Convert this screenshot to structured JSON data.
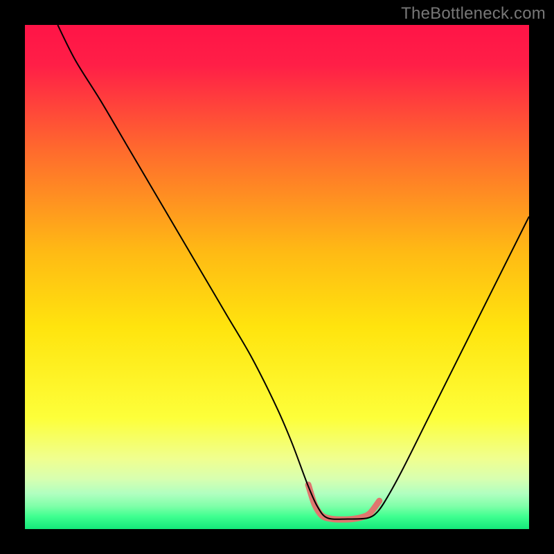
{
  "watermark": "TheBottleneck.com",
  "chart_data": {
    "type": "line",
    "title": "",
    "xlabel": "",
    "ylabel": "",
    "xlim": [
      0,
      100
    ],
    "ylim": [
      0,
      100
    ],
    "legend": false,
    "grid": false,
    "background_gradient": {
      "stops": [
        {
          "offset": 0.0,
          "color": "#ff1447"
        },
        {
          "offset": 0.08,
          "color": "#ff1f47"
        },
        {
          "offset": 0.25,
          "color": "#ff6b2d"
        },
        {
          "offset": 0.45,
          "color": "#ffba14"
        },
        {
          "offset": 0.6,
          "color": "#ffe40e"
        },
        {
          "offset": 0.78,
          "color": "#fdff3a"
        },
        {
          "offset": 0.86,
          "color": "#f0ff8f"
        },
        {
          "offset": 0.9,
          "color": "#d8ffb0"
        },
        {
          "offset": 0.93,
          "color": "#b0ffc0"
        },
        {
          "offset": 0.955,
          "color": "#7effa8"
        },
        {
          "offset": 0.975,
          "color": "#3fff90"
        },
        {
          "offset": 1.0,
          "color": "#14e87a"
        }
      ]
    },
    "series": [
      {
        "name": "bottleneck-curve",
        "color": "#000000",
        "width": 2,
        "x": [
          6.5,
          10,
          15,
          20,
          25,
          30,
          35,
          40,
          45,
          50,
          53,
          56,
          58,
          60,
          64,
          68,
          70,
          72,
          75,
          80,
          85,
          90,
          95,
          100
        ],
        "y": [
          100,
          93,
          85,
          76.5,
          68,
          59.5,
          51,
          42.5,
          34,
          24,
          17,
          9,
          4.5,
          2.2,
          2.0,
          2.2,
          3.5,
          6.5,
          12,
          22,
          32,
          42,
          52,
          62
        ]
      },
      {
        "name": "trough-highlight",
        "color": "#e0766f",
        "width": 9,
        "linecap": "round",
        "x": [
          56.2,
          57.5,
          59,
          61,
          63,
          65,
          67,
          68.5,
          70.3
        ],
        "y": [
          8.8,
          4.8,
          2.6,
          2.0,
          1.9,
          2.0,
          2.4,
          3.2,
          5.6
        ]
      }
    ]
  }
}
